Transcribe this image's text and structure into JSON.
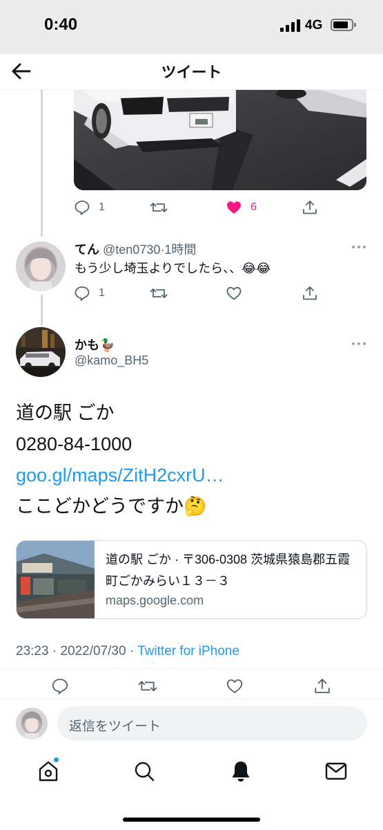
{
  "status_bar": {
    "time": "0:40",
    "network": "4G"
  },
  "nav": {
    "title": "ツイート"
  },
  "previous_tweet": {
    "actions": {
      "reply_count": "1",
      "retweet_count": "",
      "like_count": "6",
      "liked": true
    }
  },
  "reply_tweet": {
    "name": "てん",
    "handle": "@ten0730",
    "time": "1時間",
    "text": "もう少し埼玉よりでしたら、、😂😂",
    "actions": {
      "reply_count": "1"
    }
  },
  "main_tweet": {
    "name": "かも🦆",
    "handle": "@kamo_BH5",
    "lines": [
      "道の駅 ごか",
      "0280-84-1000",
      "goo.gl/maps/ZitH2cxrU…",
      "ここどかどうですか🤔"
    ],
    "card": {
      "title": "道の駅 ごか · 〒306-0308 茨城県猿島郡五霞町ごかみらい１３－３",
      "domain": "maps.google.com"
    },
    "date": "23:23 · 2022/07/30 · ",
    "source": "Twitter for iPhone"
  },
  "composer": {
    "placeholder": "返信をツイート"
  },
  "colors": {
    "accent": "#1d9bf0",
    "like": "#f91880",
    "secondary_text": "#536471"
  }
}
